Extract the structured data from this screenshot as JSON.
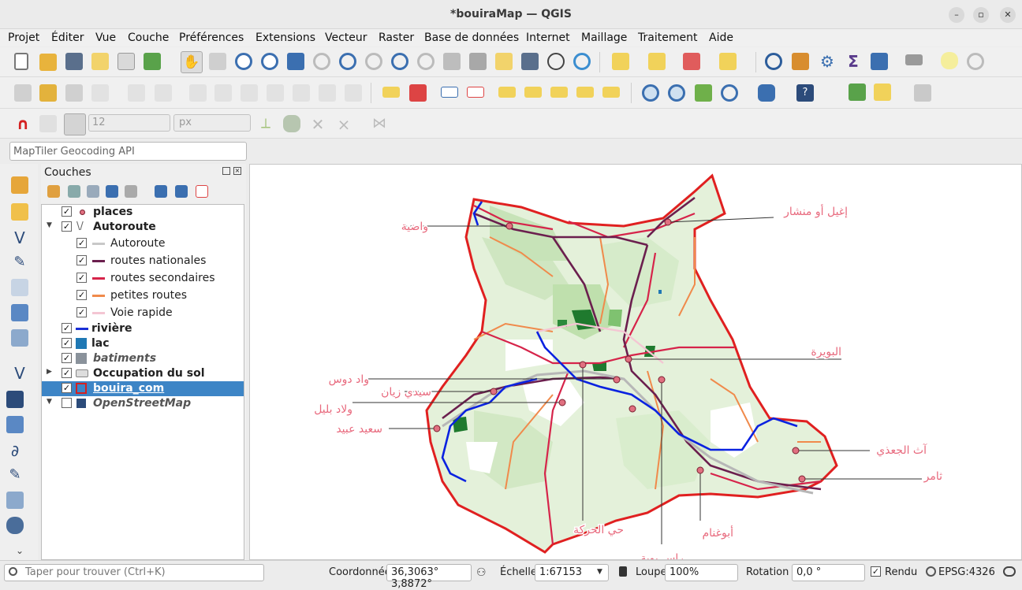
{
  "window": {
    "title": "*bouiraMap — QGIS"
  },
  "menu": [
    "Projet",
    "Éditer",
    "Vue",
    "Couche",
    "Préférences",
    "Extensions",
    "Vecteur",
    "Raster",
    "Base de données",
    "Internet",
    "Maillage",
    "Traitement",
    "Aide"
  ],
  "digitizing": {
    "snap_value": "12",
    "snap_unit": "px"
  },
  "geocoder": {
    "placeholder": "MapTiler Geocoding API"
  },
  "layers_panel": {
    "title": "Couches",
    "layers": [
      {
        "label": "places",
        "checked": true,
        "bold": true
      },
      {
        "label": "Autoroute",
        "checked": true,
        "bold": true,
        "expanded": true
      },
      {
        "label": "Autoroute",
        "checked": true,
        "child": true,
        "color": "#c8c8c8"
      },
      {
        "label": "routes nationales",
        "checked": true,
        "child": true,
        "color": "#6b1f4e"
      },
      {
        "label": "routes secondaires",
        "checked": true,
        "child": true,
        "color": "#d6244a"
      },
      {
        "label": "petites routes",
        "checked": true,
        "child": true,
        "color": "#f08a4b"
      },
      {
        "label": "Voie rapide",
        "checked": true,
        "child": true,
        "color": "#f4c6d3"
      },
      {
        "label": "rivière",
        "checked": true,
        "bold": true,
        "color": "#1a2fd6"
      },
      {
        "label": "lac",
        "checked": true,
        "bold": true,
        "color": "#1f78b4"
      },
      {
        "label": "batiments",
        "checked": true,
        "italic": true,
        "color": "#8a929b"
      },
      {
        "label": "Occupation du sol",
        "checked": true,
        "bold": true
      },
      {
        "label": "bouira_com",
        "checked": true,
        "bold": true,
        "selected": true
      },
      {
        "label": "OpenStreetMap",
        "checked": false,
        "italic": true
      }
    ]
  },
  "map": {
    "places": [
      {
        "name": "واضية"
      },
      {
        "name": "إغيل أو منشار"
      },
      {
        "name": "البويرة"
      },
      {
        "name": "واد دوس"
      },
      {
        "name": "سيدي زيان"
      },
      {
        "name": "ولاد بليل"
      },
      {
        "name": "سعيد عبيد"
      },
      {
        "name": "آث الجعذي"
      },
      {
        "name": "ثامر"
      },
      {
        "name": "حي الحركة"
      },
      {
        "name": "أبوغنام"
      },
      {
        "name": "راس بوية"
      }
    ],
    "colors": {
      "boundary": "#e02020",
      "land": "#e3f1d8",
      "forest": "#1f7a2e",
      "river": "#0a22e0",
      "national": "#6b1f4e",
      "secondary": "#d6244a",
      "small": "#f08a4b"
    }
  },
  "status": {
    "search_placeholder": "Taper pour trouver (Ctrl+K)",
    "coord_label": "Coordonnée",
    "coord_value": "36,3063° 3,8872°",
    "scale_label": "Échelle",
    "scale_value": "1:67153",
    "loupe_label": "Loupe",
    "loupe_value": "100%",
    "rotation_label": "Rotation",
    "rotation_value": "0,0 °",
    "render_label": "Rendu",
    "crs": "EPSG:4326"
  }
}
